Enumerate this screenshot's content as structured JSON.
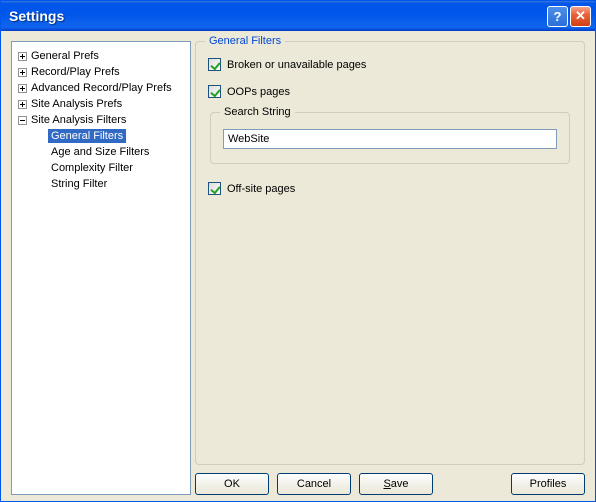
{
  "window": {
    "title": "Settings"
  },
  "tree": {
    "items": [
      {
        "label": "General Prefs",
        "expanded": false
      },
      {
        "label": "Record/Play Prefs",
        "expanded": false
      },
      {
        "label": "Advanced Record/Play Prefs",
        "expanded": false
      },
      {
        "label": "Site Analysis Prefs",
        "expanded": false
      },
      {
        "label": "Site Analysis Filters",
        "expanded": true,
        "children": [
          {
            "label": "General Filters",
            "selected": true
          },
          {
            "label": "Age and Size Filters"
          },
          {
            "label": "Complexity Filter"
          },
          {
            "label": "String Filter"
          }
        ]
      }
    ]
  },
  "panel": {
    "title": "General Filters",
    "broken_label": "Broken or unavailable pages",
    "broken_checked": true,
    "oops_label": "OOPs pages",
    "oops_checked": true,
    "search_group_title": "Search String",
    "search_value": "WebSite",
    "offsite_label": "Off-site pages",
    "offsite_checked": true
  },
  "buttons": {
    "ok": "OK",
    "cancel": "Cancel",
    "save": "Save",
    "profiles": "Profiles"
  }
}
